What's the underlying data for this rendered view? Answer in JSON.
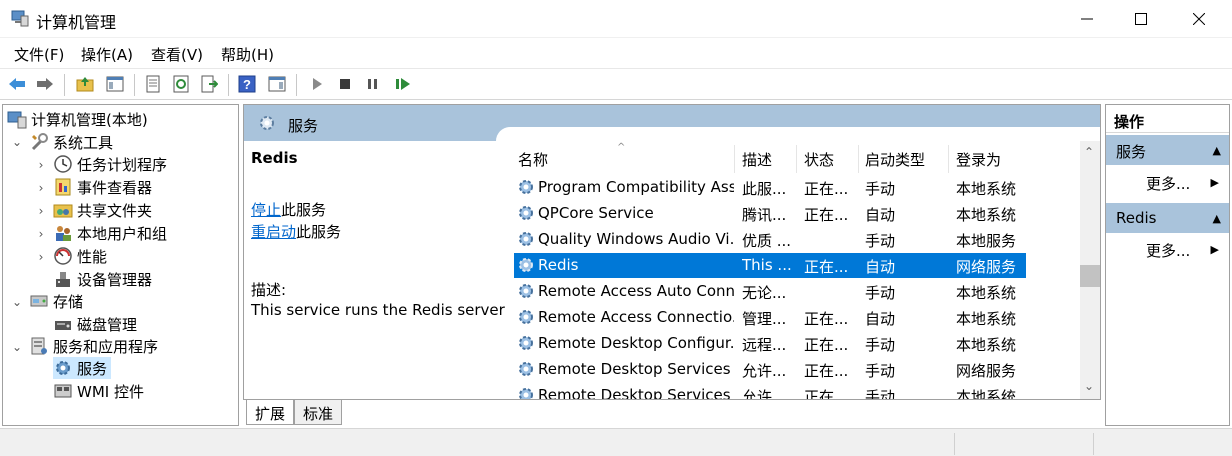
{
  "window": {
    "title": "计算机管理"
  },
  "menu": [
    "文件(F)",
    "操作(A)",
    "查看(V)",
    "帮助(H)"
  ],
  "tree": {
    "root": "计算机管理(本地)",
    "system_tools": "系统工具",
    "task_scheduler": "任务计划程序",
    "event_viewer": "事件查看器",
    "shared_folders": "共享文件夹",
    "local_users": "本地用户和组",
    "performance": "性能",
    "device_manager": "设备管理器",
    "storage": "存储",
    "disk_management": "磁盘管理",
    "services_apps": "服务和应用程序",
    "services": "服务",
    "wmi": "WMI 控件"
  },
  "center": {
    "header": "服务",
    "selected_name": "Redis",
    "stop_link": "停止",
    "stop_suffix": "此服务",
    "restart_link": "重启动",
    "restart_suffix": "此服务",
    "desc_label": "描述:",
    "desc_text": "This service runs the Redis server"
  },
  "columns": [
    "名称",
    "描述",
    "状态",
    "启动类型",
    "登录为"
  ],
  "services": [
    {
      "name": "Program Compatibility Assi...",
      "desc": "此服...",
      "status": "正在...",
      "startup": "手动",
      "logon": "本地系统"
    },
    {
      "name": "QPCore Service",
      "desc": "腾讯...",
      "status": "正在...",
      "startup": "自动",
      "logon": "本地系统"
    },
    {
      "name": "Quality Windows Audio Vi...",
      "desc": "优质 ...",
      "status": "",
      "startup": "手动",
      "logon": "本地服务"
    },
    {
      "name": "Redis",
      "desc": "This ...",
      "status": "正在...",
      "startup": "自动",
      "logon": "网络服务"
    },
    {
      "name": "Remote Access Auto Conn...",
      "desc": "无论...",
      "status": "",
      "startup": "手动",
      "logon": "本地系统"
    },
    {
      "name": "Remote Access Connectio...",
      "desc": "管理...",
      "status": "正在...",
      "startup": "自动",
      "logon": "本地系统"
    },
    {
      "name": "Remote Desktop Configur...",
      "desc": "远程...",
      "status": "正在...",
      "startup": "手动",
      "logon": "本地系统"
    },
    {
      "name": "Remote Desktop Services",
      "desc": "允许...",
      "status": "正在...",
      "startup": "手动",
      "logon": "网络服务"
    },
    {
      "name": "Remote Desktop Services ...",
      "desc": "允许...",
      "status": "正在...",
      "startup": "手动",
      "logon": "本地系统"
    }
  ],
  "tabs": [
    "扩展",
    "标准"
  ],
  "actions": {
    "title": "操作",
    "section1": "服务",
    "more1": "更多...",
    "section2": "Redis",
    "more2": "更多..."
  },
  "colors": {
    "selection": "#0078d7",
    "header_band": "#a9c3db",
    "link": "#0066cc"
  }
}
